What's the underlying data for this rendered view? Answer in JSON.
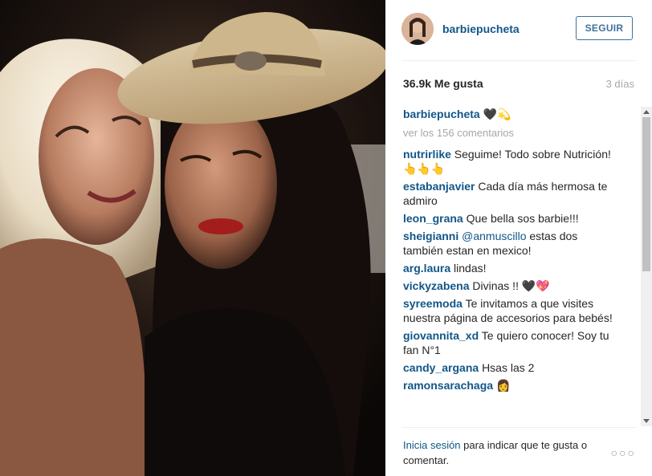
{
  "post": {
    "username": "barbiepucheta",
    "follow_label": "SEGUIR",
    "likes": "36.9k Me gusta",
    "time": "3 días",
    "caption_user": "barbiepucheta",
    "caption_text": "🖤💫",
    "view_comments": "ver los 156 comentarios"
  },
  "comments": [
    {
      "user": "nutrirlike",
      "text": "Seguime! Todo sobre Nutrición! 👆👆👆"
    },
    {
      "user": "estabanjavier",
      "text": "Cada día más hermosa te admiro"
    },
    {
      "user": "leon_grana",
      "text": "Que bella sos barbie!!!"
    },
    {
      "user": "sheigianni",
      "mention": "@anmuscillo",
      "text": "estas dos también estan en mexico!"
    },
    {
      "user": "arg.laura",
      "text": "lindas!"
    },
    {
      "user": "vickyzabena",
      "text": "Divinas !! 🖤💖"
    },
    {
      "user": "syreemoda",
      "text": "Te invitamos a que visites nuestra página de accesorios para bebés!"
    },
    {
      "user": "giovannita_xd",
      "text": "Te quiero conocer! Soy tu fan N°1"
    },
    {
      "user": "candy_argana",
      "text": "Hsas las 2"
    },
    {
      "user": "ramonsarachaga",
      "text": "👩"
    }
  ],
  "footer": {
    "login_link": "Inicia sesión",
    "rest": " para indicar que te gusta o comentar.",
    "more_label": "○○○"
  },
  "colors": {
    "link": "#125688",
    "follow_border": "#3f729b",
    "muted": "#a5a7aa",
    "text": "#262626"
  },
  "icons": {
    "options": "more-options-icon",
    "scroll_up": "arrow-up-icon",
    "scroll_down": "arrow-down-icon"
  }
}
